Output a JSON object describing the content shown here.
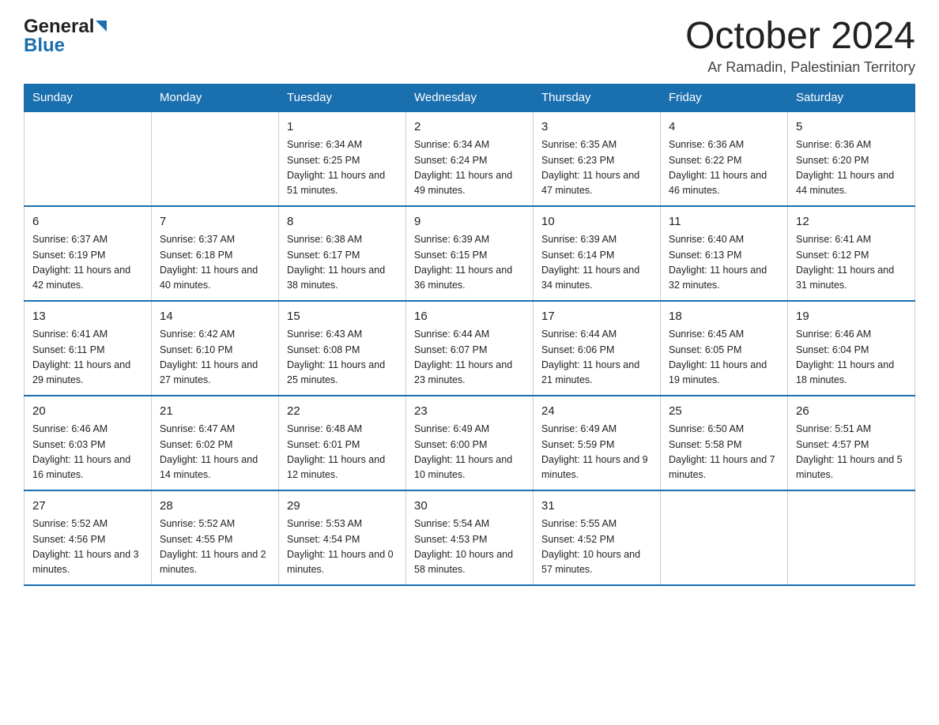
{
  "header": {
    "logo_general": "General",
    "logo_blue": "Blue",
    "month_title": "October 2024",
    "subtitle": "Ar Ramadin, Palestinian Territory"
  },
  "calendar": {
    "days_of_week": [
      "Sunday",
      "Monday",
      "Tuesday",
      "Wednesday",
      "Thursday",
      "Friday",
      "Saturday"
    ],
    "weeks": [
      [
        {
          "day": "",
          "sunrise": "",
          "sunset": "",
          "daylight": ""
        },
        {
          "day": "",
          "sunrise": "",
          "sunset": "",
          "daylight": ""
        },
        {
          "day": "1",
          "sunrise": "Sunrise: 6:34 AM",
          "sunset": "Sunset: 6:25 PM",
          "daylight": "Daylight: 11 hours and 51 minutes."
        },
        {
          "day": "2",
          "sunrise": "Sunrise: 6:34 AM",
          "sunset": "Sunset: 6:24 PM",
          "daylight": "Daylight: 11 hours and 49 minutes."
        },
        {
          "day": "3",
          "sunrise": "Sunrise: 6:35 AM",
          "sunset": "Sunset: 6:23 PM",
          "daylight": "Daylight: 11 hours and 47 minutes."
        },
        {
          "day": "4",
          "sunrise": "Sunrise: 6:36 AM",
          "sunset": "Sunset: 6:22 PM",
          "daylight": "Daylight: 11 hours and 46 minutes."
        },
        {
          "day": "5",
          "sunrise": "Sunrise: 6:36 AM",
          "sunset": "Sunset: 6:20 PM",
          "daylight": "Daylight: 11 hours and 44 minutes."
        }
      ],
      [
        {
          "day": "6",
          "sunrise": "Sunrise: 6:37 AM",
          "sunset": "Sunset: 6:19 PM",
          "daylight": "Daylight: 11 hours and 42 minutes."
        },
        {
          "day": "7",
          "sunrise": "Sunrise: 6:37 AM",
          "sunset": "Sunset: 6:18 PM",
          "daylight": "Daylight: 11 hours and 40 minutes."
        },
        {
          "day": "8",
          "sunrise": "Sunrise: 6:38 AM",
          "sunset": "Sunset: 6:17 PM",
          "daylight": "Daylight: 11 hours and 38 minutes."
        },
        {
          "day": "9",
          "sunrise": "Sunrise: 6:39 AM",
          "sunset": "Sunset: 6:15 PM",
          "daylight": "Daylight: 11 hours and 36 minutes."
        },
        {
          "day": "10",
          "sunrise": "Sunrise: 6:39 AM",
          "sunset": "Sunset: 6:14 PM",
          "daylight": "Daylight: 11 hours and 34 minutes."
        },
        {
          "day": "11",
          "sunrise": "Sunrise: 6:40 AM",
          "sunset": "Sunset: 6:13 PM",
          "daylight": "Daylight: 11 hours and 32 minutes."
        },
        {
          "day": "12",
          "sunrise": "Sunrise: 6:41 AM",
          "sunset": "Sunset: 6:12 PM",
          "daylight": "Daylight: 11 hours and 31 minutes."
        }
      ],
      [
        {
          "day": "13",
          "sunrise": "Sunrise: 6:41 AM",
          "sunset": "Sunset: 6:11 PM",
          "daylight": "Daylight: 11 hours and 29 minutes."
        },
        {
          "day": "14",
          "sunrise": "Sunrise: 6:42 AM",
          "sunset": "Sunset: 6:10 PM",
          "daylight": "Daylight: 11 hours and 27 minutes."
        },
        {
          "day": "15",
          "sunrise": "Sunrise: 6:43 AM",
          "sunset": "Sunset: 6:08 PM",
          "daylight": "Daylight: 11 hours and 25 minutes."
        },
        {
          "day": "16",
          "sunrise": "Sunrise: 6:44 AM",
          "sunset": "Sunset: 6:07 PM",
          "daylight": "Daylight: 11 hours and 23 minutes."
        },
        {
          "day": "17",
          "sunrise": "Sunrise: 6:44 AM",
          "sunset": "Sunset: 6:06 PM",
          "daylight": "Daylight: 11 hours and 21 minutes."
        },
        {
          "day": "18",
          "sunrise": "Sunrise: 6:45 AM",
          "sunset": "Sunset: 6:05 PM",
          "daylight": "Daylight: 11 hours and 19 minutes."
        },
        {
          "day": "19",
          "sunrise": "Sunrise: 6:46 AM",
          "sunset": "Sunset: 6:04 PM",
          "daylight": "Daylight: 11 hours and 18 minutes."
        }
      ],
      [
        {
          "day": "20",
          "sunrise": "Sunrise: 6:46 AM",
          "sunset": "Sunset: 6:03 PM",
          "daylight": "Daylight: 11 hours and 16 minutes."
        },
        {
          "day": "21",
          "sunrise": "Sunrise: 6:47 AM",
          "sunset": "Sunset: 6:02 PM",
          "daylight": "Daylight: 11 hours and 14 minutes."
        },
        {
          "day": "22",
          "sunrise": "Sunrise: 6:48 AM",
          "sunset": "Sunset: 6:01 PM",
          "daylight": "Daylight: 11 hours and 12 minutes."
        },
        {
          "day": "23",
          "sunrise": "Sunrise: 6:49 AM",
          "sunset": "Sunset: 6:00 PM",
          "daylight": "Daylight: 11 hours and 10 minutes."
        },
        {
          "day": "24",
          "sunrise": "Sunrise: 6:49 AM",
          "sunset": "Sunset: 5:59 PM",
          "daylight": "Daylight: 11 hours and 9 minutes."
        },
        {
          "day": "25",
          "sunrise": "Sunrise: 6:50 AM",
          "sunset": "Sunset: 5:58 PM",
          "daylight": "Daylight: 11 hours and 7 minutes."
        },
        {
          "day": "26",
          "sunrise": "Sunrise: 5:51 AM",
          "sunset": "Sunset: 4:57 PM",
          "daylight": "Daylight: 11 hours and 5 minutes."
        }
      ],
      [
        {
          "day": "27",
          "sunrise": "Sunrise: 5:52 AM",
          "sunset": "Sunset: 4:56 PM",
          "daylight": "Daylight: 11 hours and 3 minutes."
        },
        {
          "day": "28",
          "sunrise": "Sunrise: 5:52 AM",
          "sunset": "Sunset: 4:55 PM",
          "daylight": "Daylight: 11 hours and 2 minutes."
        },
        {
          "day": "29",
          "sunrise": "Sunrise: 5:53 AM",
          "sunset": "Sunset: 4:54 PM",
          "daylight": "Daylight: 11 hours and 0 minutes."
        },
        {
          "day": "30",
          "sunrise": "Sunrise: 5:54 AM",
          "sunset": "Sunset: 4:53 PM",
          "daylight": "Daylight: 10 hours and 58 minutes."
        },
        {
          "day": "31",
          "sunrise": "Sunrise: 5:55 AM",
          "sunset": "Sunset: 4:52 PM",
          "daylight": "Daylight: 10 hours and 57 minutes."
        },
        {
          "day": "",
          "sunrise": "",
          "sunset": "",
          "daylight": ""
        },
        {
          "day": "",
          "sunrise": "",
          "sunset": "",
          "daylight": ""
        }
      ]
    ]
  }
}
